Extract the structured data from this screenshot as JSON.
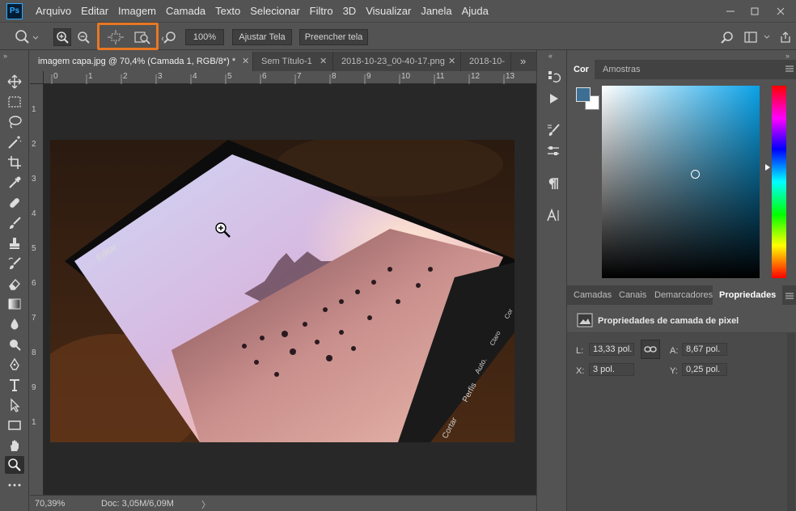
{
  "menubar": {
    "items": [
      "Arquivo",
      "Editar",
      "Imagem",
      "Camada",
      "Texto",
      "Selecionar",
      "Filtro",
      "3D",
      "Visualizar",
      "Janela",
      "Ajuda"
    ]
  },
  "options": {
    "zoom_value": "100%",
    "fit_screen": "Ajustar Tela",
    "fill_screen": "Preencher tela"
  },
  "tabs": [
    {
      "label": "imagem capa.jpg @ 70,4% (Camada 1, RGB/8*) *",
      "active": true
    },
    {
      "label": "Sem Título-1",
      "active": false
    },
    {
      "label": "2018-10-23_00-40-17.png",
      "active": false
    },
    {
      "label": "2018-10-",
      "active": false
    }
  ],
  "ruler": {
    "top": [
      "0",
      "1",
      "2",
      "3",
      "4",
      "5",
      "6",
      "7",
      "8",
      "9",
      "10",
      "11",
      "12",
      "13"
    ],
    "left": [
      "1",
      "2",
      "3",
      "4",
      "5",
      "6",
      "7",
      "8",
      "9",
      "1"
    ]
  },
  "status": {
    "zoom": "70,39%",
    "doc": "Doc: 3,05M/6,09M"
  },
  "color_panel": {
    "tabs": [
      "Cor",
      "Amostras"
    ],
    "foreground": "#3d6f94",
    "background": "#ffffff"
  },
  "props_panel": {
    "tabs": [
      "Camadas",
      "Canais",
      "Demarcadores",
      "Propriedades"
    ],
    "title": "Propriedades de camada de pixel",
    "l_label": "L:",
    "l_value": "13,33 pol.",
    "a_label": "A:",
    "a_value": "8,67 pol.",
    "x_label": "X:",
    "x_value": "3 pol.",
    "y_label": "Y:",
    "y_value": "0,25 pol."
  },
  "photo_overlay": {
    "editar": "Editar",
    "cortar": "Cortar",
    "perfis": "Perfis",
    "auto": "Auto.",
    "claro": "Claro",
    "cor": "Cor"
  },
  "colors": {
    "accent_highlight": "#e87722",
    "ps_blue": "#31a8ff"
  }
}
